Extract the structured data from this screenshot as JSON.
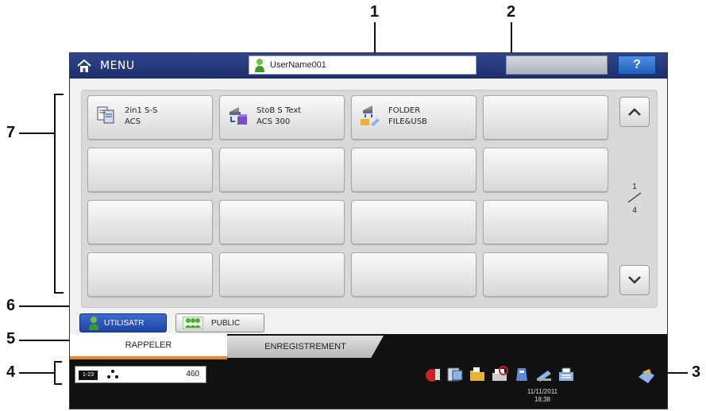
{
  "callouts": [
    "1",
    "2",
    "3",
    "4",
    "5",
    "6",
    "7"
  ],
  "header": {
    "menu_label": "MENU",
    "user_name": "UserName001",
    "help_label": "?"
  },
  "templates": [
    {
      "line1": "2in1 S-S",
      "line2": "ACS",
      "icon": "copy-duplex-icon"
    },
    {
      "line1": "StoB S Text",
      "line2": "ACS 300",
      "icon": "scan-to-box-icon"
    },
    {
      "line1": "FOLDER",
      "line2": "FILE&USB",
      "icon": "scan-to-folder-icon"
    }
  ],
  "pagination": {
    "current": "1",
    "total": "4"
  },
  "filters": {
    "user_label": "UTILISATR",
    "public_label": "PUBLIC"
  },
  "tabs": {
    "recall": "RAPPELER",
    "register": "ENREGISTREMENT"
  },
  "status": {
    "counter_id": "1-23",
    "counter_value": "460",
    "date": "11/11/2011",
    "time": "18:38"
  },
  "colors": {
    "header_bar": "#1e2f6a",
    "active_tab_accent": "#e8882a",
    "user_button": "#1d44a4"
  }
}
